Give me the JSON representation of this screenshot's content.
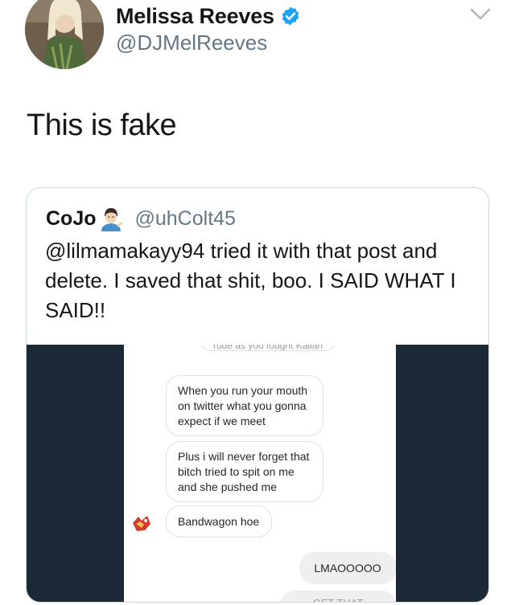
{
  "author": {
    "name": "Melissa Reeves",
    "handle": "@DJMelReeves",
    "verified": true,
    "avatar_icon": "profile-photo",
    "verified_color": "#1da1f2"
  },
  "tweet": {
    "text": "This is fake"
  },
  "quoted_tweet": {
    "name": "CoJo",
    "emoji_icon": "man-tipping-hand-emoji",
    "handle": "@uhColt45",
    "text": "@lilmamakayy94 tried it with that post and delete. I saved that shit, boo. I SAID WHAT I SAID!!"
  },
  "screenshot_media": {
    "messages": [
      {
        "text": "rude as you fought Kailah",
        "direction": "incoming"
      },
      {
        "text": "When you run your mouth on twitter what you gonna expect if we meet",
        "direction": "incoming"
      },
      {
        "text": "Plus i will never forget that bitch tried to spit on me and she pushed me",
        "direction": "incoming"
      },
      {
        "text": "Bandwagon hoe",
        "direction": "incoming"
      },
      {
        "text": "LMAOOOOO",
        "direction": "outgoing"
      },
      {
        "text": "GET THAT BITCHH",
        "direction": "outgoing"
      }
    ],
    "sticker_icon": "red-cartoon-sticker"
  },
  "colors": {
    "text": "#14171a",
    "secondary_text": "#657786",
    "border": "#ccd6dd",
    "media_background": "#1b2836"
  }
}
